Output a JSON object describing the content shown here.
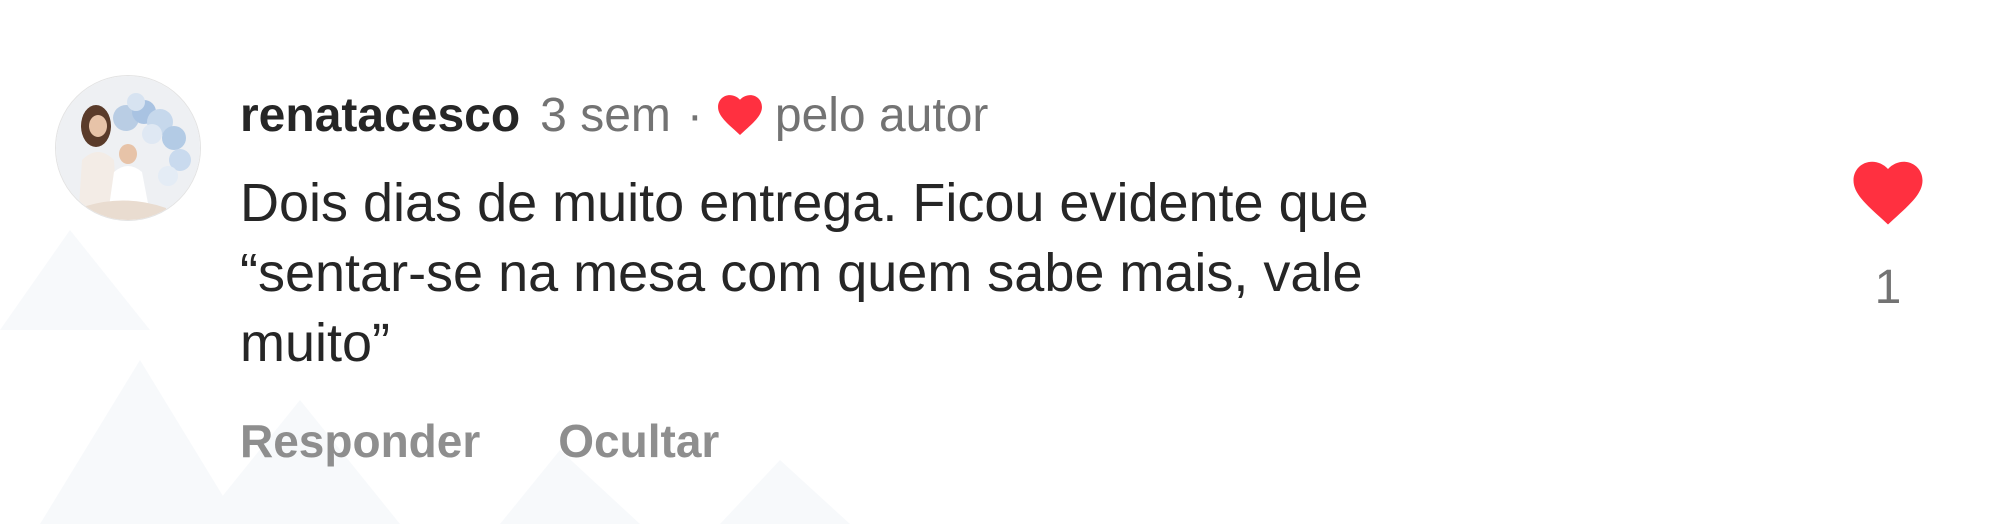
{
  "comment": {
    "username": "renatacesco",
    "time_ago": "3 sem",
    "separator": "·",
    "liked_by_author_label": "pelo autor",
    "text": "Dois dias de muito entrega. Ficou evidente que\n“sentar-se na mesa com quem sabe mais, vale\nmuito”",
    "like_count": "1",
    "actions": {
      "reply_label": "Responder",
      "hide_label": "Ocultar"
    },
    "avatar_icon": "user-avatar-photo",
    "heart_icon": "heart-icon",
    "heart_color": "#ff3040",
    "secondary_text_color": "#737373",
    "action_text_color": "#8e8e8e"
  }
}
